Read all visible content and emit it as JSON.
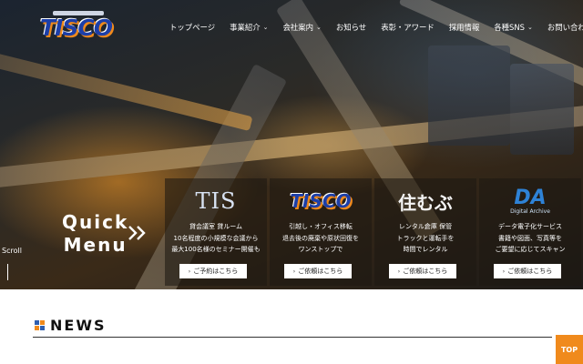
{
  "logo": {
    "text": "TISCO"
  },
  "nav": {
    "items": [
      {
        "label": "トップページ",
        "dropdown": false
      },
      {
        "label": "事業紹介",
        "dropdown": true
      },
      {
        "label": "会社案内",
        "dropdown": true
      },
      {
        "label": "お知らせ",
        "dropdown": false
      },
      {
        "label": "表彰・アワード",
        "dropdown": false
      },
      {
        "label": "採用情報",
        "dropdown": false
      },
      {
        "label": "各種SNS",
        "dropdown": true
      },
      {
        "label": "お問い合わせ",
        "dropdown": false
      }
    ]
  },
  "hero": {
    "quick_line1": "Quick",
    "quick_line2": "Menu",
    "scroll_label": "Scroll"
  },
  "cards": [
    {
      "logo": "TIS",
      "desc1": "貸会議室 貸ルーム",
      "desc2": "10名程度の小規模な会議から",
      "desc3": "最大100名様のセミナー開催も",
      "button": "ご予約はこちら"
    },
    {
      "logo": "TISCO",
      "desc1": "引越し・オフィス移転",
      "desc2": "退去後の廃棄や原状回復を",
      "desc3": "ワンストップで",
      "button": "ご依頼はこちら"
    },
    {
      "logo": "住むぶ",
      "desc1": "レンタル倉庫 保管",
      "desc2": "トラックと運転手を",
      "desc3": "時間でレンタル",
      "button": "ご依頼はこちら"
    },
    {
      "logo": "DA",
      "logo_sub": "Digital Archive",
      "desc1": "データ電子化サービス",
      "desc2": "書籍や図面、写真等を",
      "desc3": "ご要望に応じてスキャン",
      "button": "ご依頼はこちら"
    }
  ],
  "news": {
    "title": "NEWS"
  },
  "top_button": "TOP",
  "colors": {
    "accent": "#f08a1c",
    "brand_blue": "#1d3fa8",
    "news_mark_blue": "#2e5fb0"
  }
}
